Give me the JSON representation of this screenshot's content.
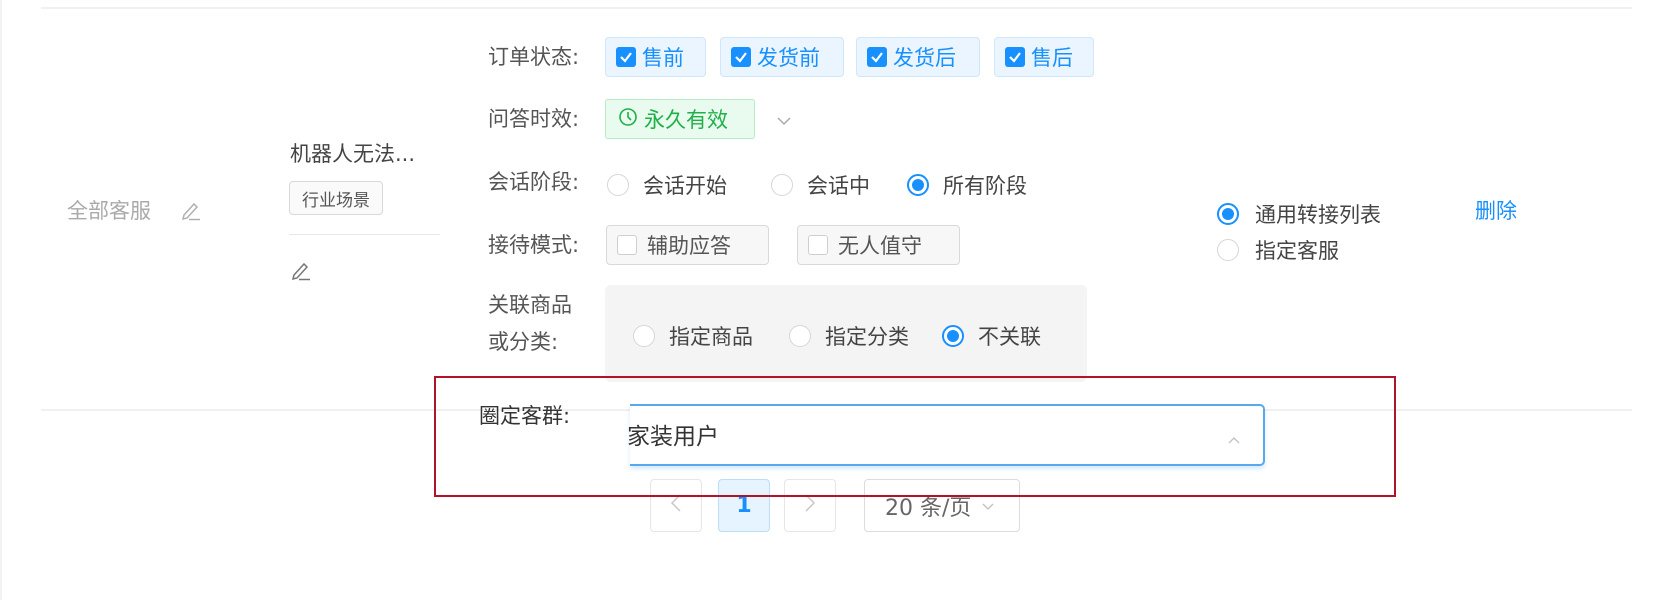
{
  "row": {
    "agent_scope": "全部客服",
    "scenario": {
      "title": "机器人无法...",
      "tag": "行业场景"
    },
    "conditions": {
      "order_status": {
        "label": "订单状态:",
        "options": [
          {
            "label": "售前",
            "checked": true
          },
          {
            "label": "发货前",
            "checked": true
          },
          {
            "label": "发货后",
            "checked": true
          },
          {
            "label": "售后",
            "checked": true
          }
        ]
      },
      "qa_validity": {
        "label": "问答时效:",
        "value": "永久有效"
      },
      "session_stage": {
        "label": "会话阶段:",
        "options": [
          {
            "label": "会话开始",
            "selected": false
          },
          {
            "label": "会话中",
            "selected": false
          },
          {
            "label": "所有阶段",
            "selected": true
          }
        ]
      },
      "reception_mode": {
        "label": "接待模式:",
        "options": [
          {
            "label": "辅助应答",
            "checked": false
          },
          {
            "label": "无人值守",
            "checked": false
          }
        ]
      },
      "related_goods": {
        "label_line1": "关联商品",
        "label_line2": "或分类:",
        "options": [
          {
            "label": "指定商品",
            "selected": false
          },
          {
            "label": "指定分类",
            "selected": false
          },
          {
            "label": "不关联",
            "selected": true
          }
        ]
      },
      "customer_group": {
        "label": "圈定客群:",
        "value": "家装用户"
      }
    },
    "transfer": {
      "options": [
        {
          "label": "通用转接列表",
          "selected": true
        },
        {
          "label": "指定客服",
          "selected": false
        }
      ]
    },
    "delete_label": "删除"
  },
  "pagination": {
    "current_page": "1",
    "page_size": "20 条/页"
  },
  "colors": {
    "primary": "#1890ff",
    "success": "#1fb04a",
    "highlight": "#b3122b"
  }
}
